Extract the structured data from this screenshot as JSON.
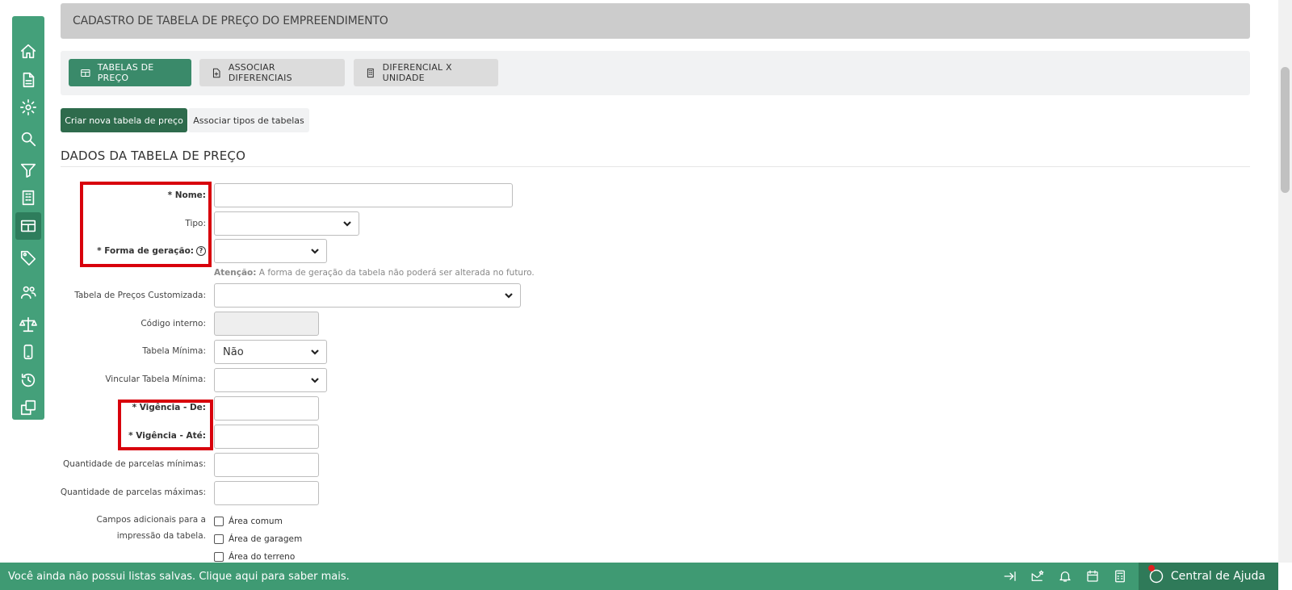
{
  "header": {
    "title": "CADASTRO DE TABELA DE PREÇO DO EMPREENDIMENTO"
  },
  "tabs": [
    {
      "label": "TABELAS DE PREÇO",
      "icon": "table-icon"
    },
    {
      "label": "ASSOCIAR DIFERENCIAIS",
      "icon": "file-plus-icon"
    },
    {
      "label": "DIFERENCIAL X UNIDADE",
      "icon": "building-icon"
    }
  ],
  "actions": {
    "new_table": "Criar nova tabela de preço",
    "assoc_types": "Associar tipos de tabelas"
  },
  "section": {
    "title": "DADOS DA TABELA DE PREÇO"
  },
  "form": {
    "nome": {
      "label": "* Nome:",
      "value": ""
    },
    "tipo": {
      "label": "Tipo:",
      "value": ""
    },
    "forma": {
      "label": "* Forma de geração:",
      "value": "",
      "help": "?"
    },
    "note_strong": "Atenção:",
    "note_text": " A forma de geração da tabela não poderá ser alterada no futuro.",
    "custom": {
      "label": "Tabela de Preços Customizada:",
      "value": ""
    },
    "codigo": {
      "label": "Código interno:",
      "value": ""
    },
    "minima": {
      "label": "Tabela Mínima:",
      "value": "Não"
    },
    "vincular": {
      "label": "Vincular Tabela Mínima:",
      "value": ""
    },
    "vig_de": {
      "label": "* Vigência - De:",
      "value": ""
    },
    "vig_ate": {
      "label": "* Vigência - Até:",
      "value": ""
    },
    "parc_min": {
      "label": "Quantidade de parcelas mínimas:",
      "value": ""
    },
    "parc_max": {
      "label": "Quantidade de parcelas máximas:",
      "value": ""
    },
    "campos_label_1": "Campos adicionais para a",
    "campos_label_2": "impressão da tabela.",
    "checkboxes": [
      "Área comum",
      "Área de garagem",
      "Área do terreno"
    ]
  },
  "footer": {
    "message": "Você ainda não possui listas salvas. Clique aqui para saber mais.",
    "help_center": "Central de Ajuda"
  },
  "colors": {
    "sidebar": "#44a07a",
    "primary": "#3a8a6a",
    "footer": "#3f9a73",
    "highlight": "#d8000c"
  }
}
